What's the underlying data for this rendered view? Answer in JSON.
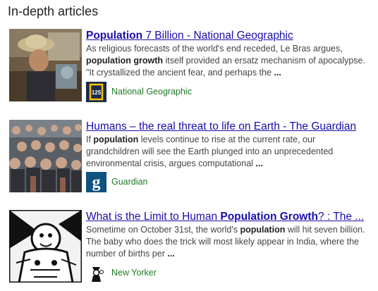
{
  "section": {
    "heading": "In-depth articles"
  },
  "articles": [
    {
      "title_bold": "Population",
      "title_rest": " 7 Billion - National Geographic",
      "snippet": [
        {
          "t": "As religious forecasts of the world's end receded, Le Bras argues, ",
          "b": false
        },
        {
          "t": "population growth",
          "b": true
        },
        {
          "t": " itself provided an ersatz mechanism of apocalypse. \"It crystallized the ancient fear, and perhaps the ",
          "b": false
        },
        {
          "t": "...",
          "b": true
        }
      ],
      "source": "National Geographic",
      "logo_text": "125",
      "logo_icon": "national-geographic-logo"
    },
    {
      "title_plain": "Humans – the real threat to life on Earth - The Guardian",
      "snippet": [
        {
          "t": "If ",
          "b": false
        },
        {
          "t": "population",
          "b": true
        },
        {
          "t": " levels continue to rise at the current rate, our grandchildren will see the Earth plunged into an unprecedented environmental crisis, argues computational ",
          "b": false
        },
        {
          "t": "...",
          "b": true
        }
      ],
      "source": "Guardian",
      "logo_text": "g",
      "logo_icon": "guardian-logo"
    },
    {
      "title_pre": "What is the Limit to Human ",
      "title_bold": "Population Growth",
      "title_post": "? : The ...",
      "snippet": [
        {
          "t": "Sometime on October 31st, the world's ",
          "b": false
        },
        {
          "t": "population",
          "b": true
        },
        {
          "t": " will hit seven billion. The baby who does the trick will most likely appear in India, where the number of births per ",
          "b": false
        },
        {
          "t": "...",
          "b": true
        }
      ],
      "source": "New Yorker",
      "logo_icon": "new-yorker-logo"
    }
  ],
  "colors": {
    "link": "#1a0dab",
    "source": "#1f7a25",
    "snippet": "#444444",
    "guardian_blue": "#0d5280"
  }
}
